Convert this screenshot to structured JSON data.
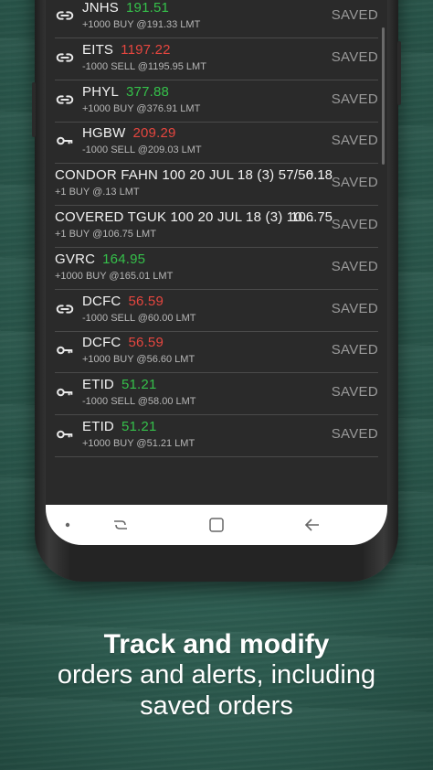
{
  "orders": [
    {
      "icon": "link-icon",
      "symbol": "JNHS",
      "price": "191.51",
      "trend": "up",
      "detail": "+1000 BUY @191.33 LMT",
      "status": "SAVED"
    },
    {
      "icon": "link-icon",
      "symbol": "EITS",
      "price": "1197.22",
      "trend": "down",
      "detail": "-1000 SELL @1195.95 LMT",
      "status": "SAVED"
    },
    {
      "icon": "link-icon",
      "symbol": "PHYL",
      "price": "377.88",
      "trend": "up",
      "detail": "+1000 BUY @376.91 LMT",
      "status": "SAVED"
    },
    {
      "icon": "key-icon",
      "symbol": "HGBW",
      "price": "209.29",
      "trend": "down",
      "detail": "-1000 SELL @209.03 LMT",
      "status": "SAVED"
    },
    {
      "icon": "",
      "symbol": "CONDOR FAHN 100 20 JUL 18 (3) 57/56...",
      "price": "",
      "trend": "",
      "option_price": "0.18",
      "detail": "+1 BUY @.13 LMT",
      "status": "SAVED"
    },
    {
      "icon": "",
      "symbol": "COVERED TGUK 100 20 JUL 18 (3) 10...",
      "price": "",
      "trend": "",
      "option_price": "106.75",
      "detail": "+1 BUY @106.75 LMT",
      "status": "SAVED"
    },
    {
      "icon": "",
      "symbol": "GVRC",
      "price": "164.95",
      "trend": "up",
      "detail": "+1000 BUY @165.01 LMT",
      "status": "SAVED"
    },
    {
      "icon": "link-icon",
      "symbol": "DCFC",
      "price": "56.59",
      "trend": "down",
      "detail": "-1000 SELL @60.00 LMT",
      "status": "SAVED"
    },
    {
      "icon": "key-icon",
      "symbol": "DCFC",
      "price": "56.59",
      "trend": "down",
      "detail": "+1000 BUY @56.60 LMT",
      "status": "SAVED"
    },
    {
      "icon": "key-icon",
      "symbol": "ETID",
      "price": "51.21",
      "trend": "up",
      "detail": "-1000 SELL @58.00 LMT",
      "status": "SAVED"
    },
    {
      "icon": "key-icon",
      "symbol": "ETID",
      "price": "51.21",
      "trend": "up",
      "detail": "+1000 BUY @51.21 LMT",
      "status": "SAVED"
    }
  ],
  "navbar": {
    "items": [
      "dot-icon",
      "recent-apps-icon",
      "home-icon",
      "back-icon"
    ]
  },
  "caption": {
    "headline": "Track and modify",
    "line1": "orders and alerts, including",
    "line2": "saved orders"
  },
  "colors": {
    "up": "#35c04a",
    "down": "#e5463f",
    "background": "#2f5f53"
  }
}
